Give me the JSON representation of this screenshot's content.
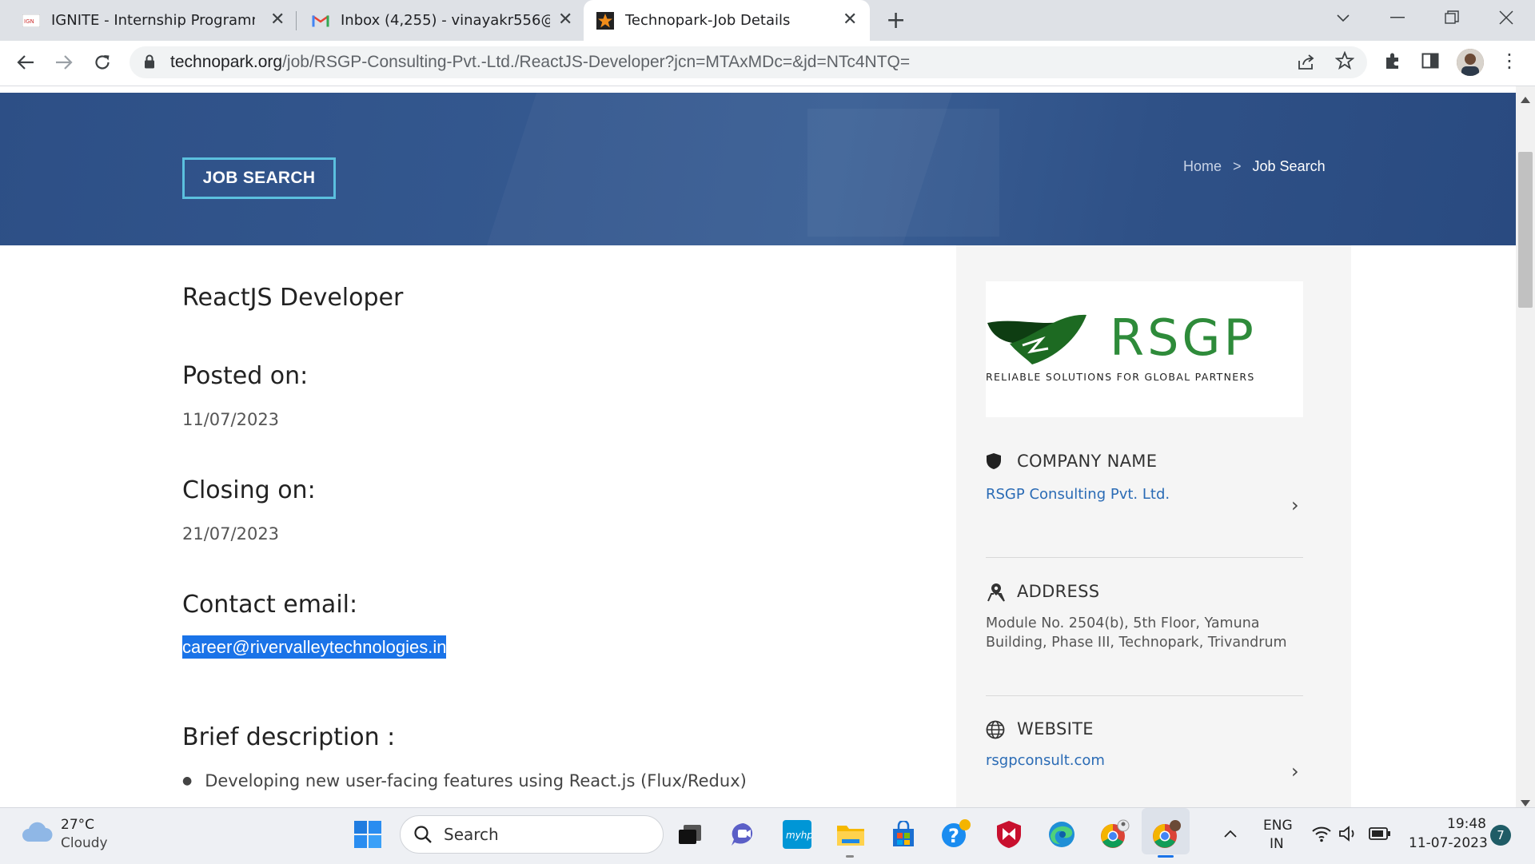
{
  "browser": {
    "tabs": [
      {
        "title": "IGNITE - Internship Programme |",
        "favicon": "ignite-favicon"
      },
      {
        "title": "Inbox (4,255) - vinayakr556@gm",
        "favicon": "gmail-icon"
      },
      {
        "title": "Technopark-Job Details",
        "favicon": "technopark-star-icon"
      }
    ],
    "url_host": "technopark.org",
    "url_path": "/job/RSGP-Consulting-Pvt.-Ltd./ReactJS-Developer?jcn=MTAxMDc=&jd=NTc4NTQ="
  },
  "banner": {
    "button_label": "JOB SEARCH",
    "breadcrumb": {
      "home": "Home",
      "separator": ">",
      "current": "Job Search"
    }
  },
  "job": {
    "title": "ReactJS Developer",
    "posted_label": "Posted on:",
    "posted_value": "11/07/2023",
    "closing_label": "Closing on:",
    "closing_value": "21/07/2023",
    "contact_label": "Contact email:",
    "contact_value": "career@rivervalleytechnologies.in",
    "brief_label": "Brief description :",
    "brief_items": [
      "Developing new user-facing features using React.js (Flux/Redux)"
    ]
  },
  "sidebar": {
    "logo_text": "RSGP",
    "logo_tagline": "RELIABLE SOLUTIONS FOR GLOBAL PARTNERS",
    "company_heading": "COMPANY NAME",
    "company_value": "RSGP Consulting Pvt. Ltd.",
    "address_heading": "ADDRESS",
    "address_value": "Module No. 2504(b), 5th Floor, Yamuna Building, Phase III, Technopark, Trivandrum",
    "website_heading": "WEBSITE",
    "website_value": "rsgpconsult.com"
  },
  "taskbar": {
    "weather_temp": "27°C",
    "weather_desc": "Cloudy",
    "search_placeholder": "Search",
    "lang_line1": "ENG",
    "lang_line2": "IN",
    "time": "19:48",
    "date": "11-07-2023",
    "notification_count": "7"
  },
  "colors": {
    "banner": "#2f5187",
    "accent": "#5bc0de",
    "link": "#2a6bb5",
    "selection": "#1a73e8",
    "logo_green": "#2e8b3a"
  }
}
